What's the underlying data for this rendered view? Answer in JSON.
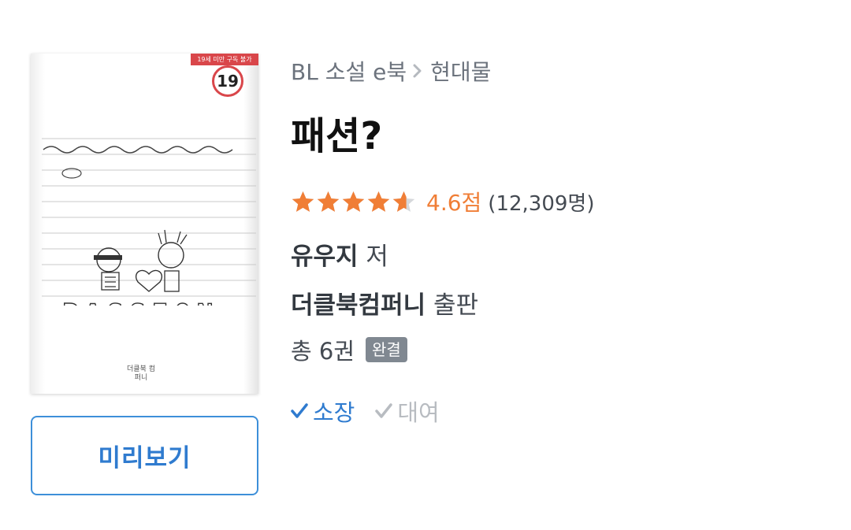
{
  "cover": {
    "age_banner": "19세 미만 구독 불가",
    "age_rating": "19",
    "art_title": "PASSION",
    "publisher_mark": "더클북 컴퍼니"
  },
  "preview_button": {
    "label": "미리보기"
  },
  "breadcrumb": {
    "category": "BL 소설 e북",
    "subcategory": "현대물"
  },
  "book": {
    "title": "패션?",
    "rating": {
      "stars_value": 4.6,
      "score_text": "4.6점",
      "count_text": "(12,309명)"
    },
    "author": {
      "name": "유우지",
      "suffix": "저"
    },
    "publisher": {
      "name": "더클북컴퍼니",
      "suffix": "출판"
    },
    "volumes_text": "총 6권",
    "status_badge": "완결"
  },
  "ownership": {
    "own_label": "소장",
    "rent_label": "대여",
    "own_icon": "check-icon",
    "rent_icon": "check-icon"
  },
  "colors": {
    "accent_blue": "#2f7bcf",
    "star_orange": "#f07e36",
    "star_empty": "#d6d8db",
    "age_red": "#d9464a",
    "badge_gray": "#808891"
  }
}
